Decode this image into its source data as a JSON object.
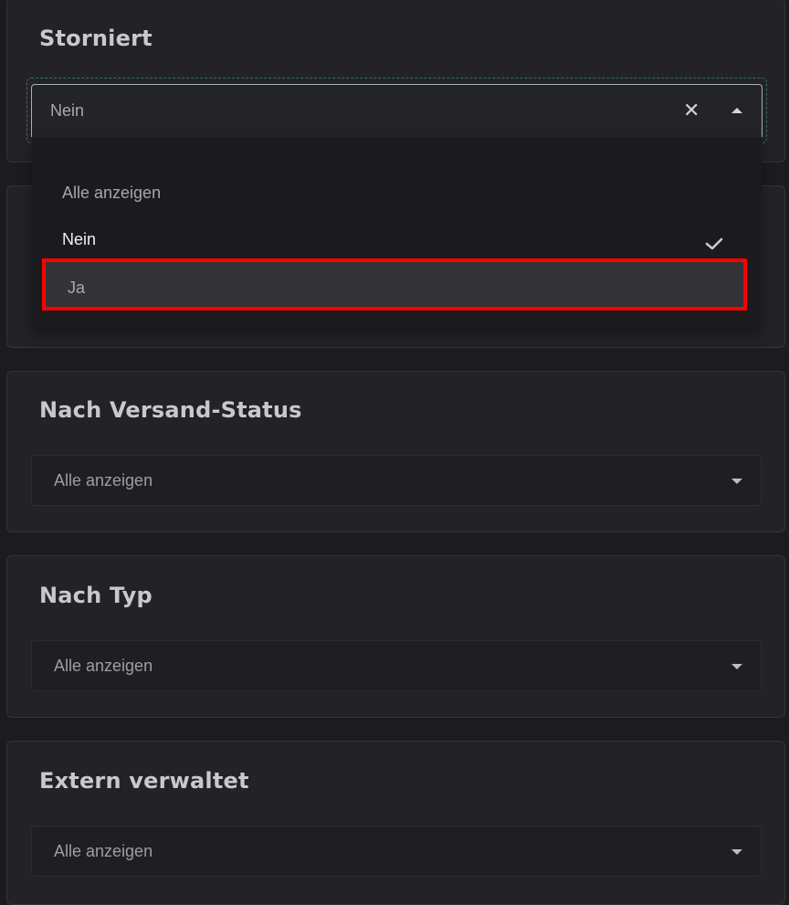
{
  "filters": {
    "storniert": {
      "title": "Storniert",
      "selected_value": "Nein",
      "options": [
        "Alle anzeigen",
        "Nein",
        "Ja"
      ],
      "checked_option": "Nein",
      "highlighted_option": "Ja"
    },
    "versand_status": {
      "title": "Nach Versand-Status",
      "value": "Alle anzeigen"
    },
    "typ": {
      "title": "Nach Typ",
      "value": "Alle anzeigen"
    },
    "extern": {
      "title": "Extern verwaltet",
      "value": "Alle anzeigen"
    }
  },
  "icons": {
    "clear": "close-icon",
    "open_caret": "caret-up-icon",
    "closed_caret": "caret-down-icon",
    "checked": "checkmark-icon"
  },
  "colors": {
    "background": "#1c1c1f",
    "card": "#232327",
    "highlight_outline": "#ff0000"
  }
}
